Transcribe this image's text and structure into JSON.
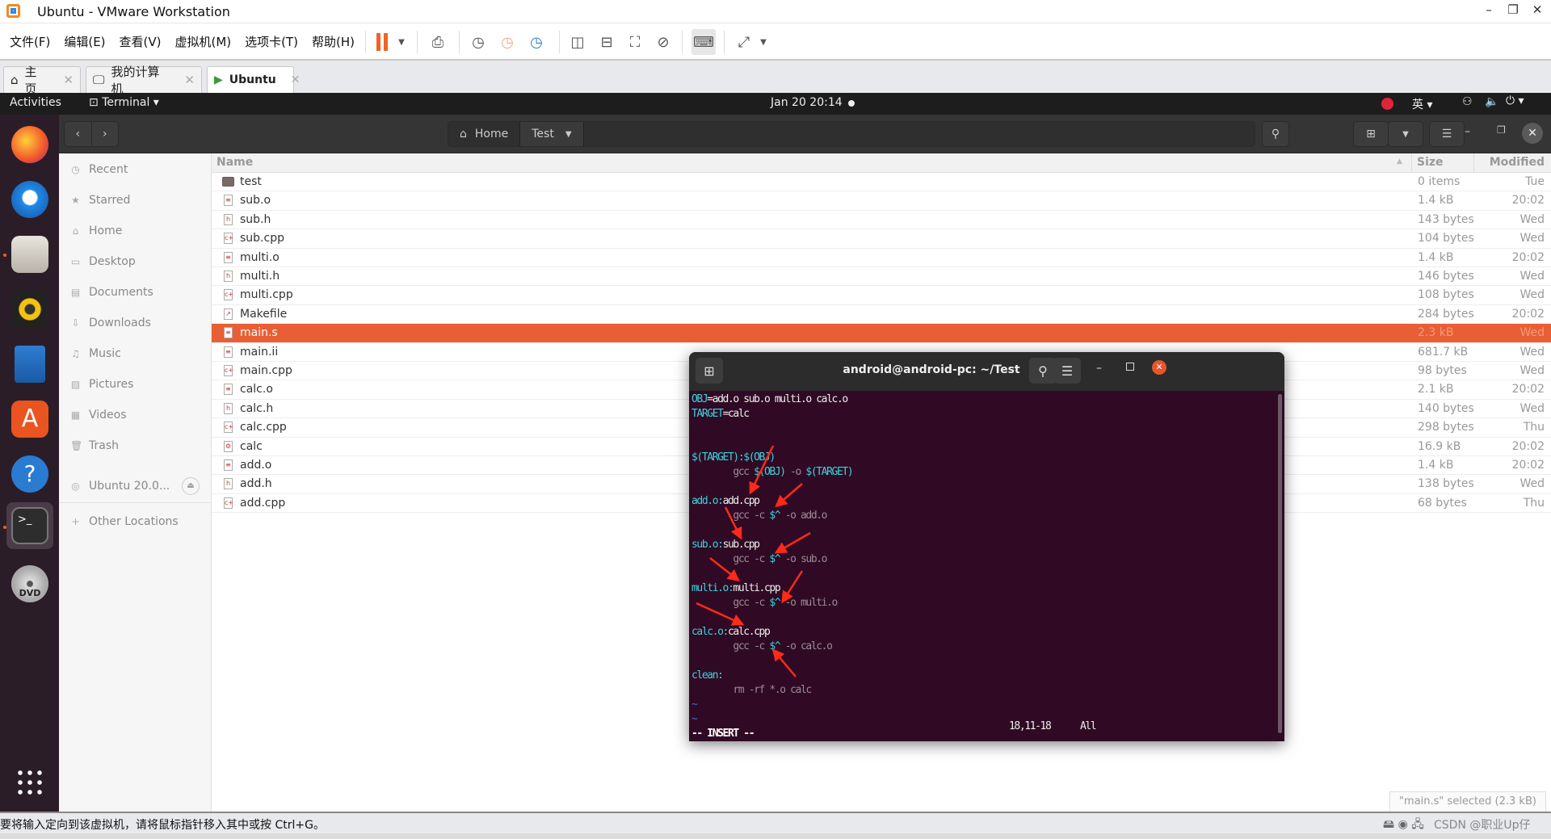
{
  "window": {
    "title": "Ubuntu - VMware Workstation",
    "icon": "vmware-icon"
  },
  "menu": [
    "文件(F)",
    "编辑(E)",
    "查看(V)",
    "虚拟机(M)",
    "选项卡(T)",
    "帮助(H)"
  ],
  "tabs": [
    {
      "label": "主页",
      "icon": "home-icon"
    },
    {
      "label": "我的计算机",
      "icon": "computer-icon"
    },
    {
      "label": "Ubuntu",
      "icon": "vm-running-icon",
      "active": true
    }
  ],
  "topbar": {
    "activities": "Activities",
    "app": "Terminal",
    "clock": "Jan 20  20:14",
    "input_method": "英"
  },
  "files": {
    "path": [
      "Home",
      "Test"
    ],
    "columns": {
      "name": "Name",
      "size": "Size",
      "modified": "Modified"
    },
    "sidebar": [
      {
        "label": "Recent",
        "icon": "clock-icon"
      },
      {
        "label": "Starred",
        "icon": "star-icon"
      },
      {
        "label": "Home",
        "icon": "home-icon"
      },
      {
        "label": "Desktop",
        "icon": "desktop-icon"
      },
      {
        "label": "Documents",
        "icon": "document-icon"
      },
      {
        "label": "Downloads",
        "icon": "download-icon"
      },
      {
        "label": "Music",
        "icon": "music-icon"
      },
      {
        "label": "Pictures",
        "icon": "picture-icon"
      },
      {
        "label": "Videos",
        "icon": "video-icon"
      },
      {
        "label": "Trash",
        "icon": "trash-icon"
      }
    ],
    "device": "Ubuntu 20.0...",
    "other_locations": "Other Locations",
    "rows": [
      {
        "name": "test",
        "size": "0 items",
        "modified": "Tue",
        "type": "folder"
      },
      {
        "name": "sub.o",
        "size": "1.4 kB",
        "modified": "20:02",
        "type": "o"
      },
      {
        "name": "sub.h",
        "size": "143 bytes",
        "modified": "Wed",
        "type": "h"
      },
      {
        "name": "sub.cpp",
        "size": "104 bytes",
        "modified": "Wed",
        "type": "cpp"
      },
      {
        "name": "multi.o",
        "size": "1.4 kB",
        "modified": "20:02",
        "type": "o"
      },
      {
        "name": "multi.h",
        "size": "146 bytes",
        "modified": "Wed",
        "type": "h"
      },
      {
        "name": "multi.cpp",
        "size": "108 bytes",
        "modified": "Wed",
        "type": "cpp"
      },
      {
        "name": "Makefile",
        "size": "284 bytes",
        "modified": "20:02",
        "type": "make"
      },
      {
        "name": "main.s",
        "size": "2.3 kB",
        "modified": "Wed",
        "type": "s",
        "selected": true
      },
      {
        "name": "main.ii",
        "size": "681.7 kB",
        "modified": "Wed",
        "type": "ii"
      },
      {
        "name": "main.cpp",
        "size": "98 bytes",
        "modified": "Wed",
        "type": "cpp"
      },
      {
        "name": "calc.o",
        "size": "2.1 kB",
        "modified": "20:02",
        "type": "o"
      },
      {
        "name": "calc.h",
        "size": "140 bytes",
        "modified": "Wed",
        "type": "h"
      },
      {
        "name": "calc.cpp",
        "size": "298 bytes",
        "modified": "Thu",
        "type": "cpp"
      },
      {
        "name": "calc",
        "size": "16.9 kB",
        "modified": "20:02",
        "type": "exe"
      },
      {
        "name": "add.o",
        "size": "1.4 kB",
        "modified": "20:02",
        "type": "o"
      },
      {
        "name": "add.h",
        "size": "138 bytes",
        "modified": "Wed",
        "type": "h"
      },
      {
        "name": "add.cpp",
        "size": "68 bytes",
        "modified": "Thu",
        "type": "cpp"
      }
    ],
    "selection_status": "\"main.s\" selected (2.3 kB)"
  },
  "terminal": {
    "title": "android@android-pc: ~/Test",
    "lines": [
      [
        [
          "OBJ",
          "cyan"
        ],
        [
          "=add.o sub.o multi.o calc.o",
          "white"
        ]
      ],
      [
        [
          "TARGET",
          "cyan"
        ],
        [
          "=calc",
          "white"
        ]
      ],
      [],
      [],
      [
        [
          "$(TARGET):$(OBJ)",
          "cyan"
        ]
      ],
      [
        [
          "        gcc ",
          "gray"
        ],
        [
          "$(OBJ)",
          "cyan"
        ],
        [
          " -o ",
          "gray"
        ],
        [
          "$(TARGET)",
          "cyan"
        ]
      ],
      [],
      [
        [
          "add.o:",
          "cyan"
        ],
        [
          "add.cpp",
          "white"
        ]
      ],
      [
        [
          "        gcc -c ",
          "gray"
        ],
        [
          "$^",
          "cyan"
        ],
        [
          " -o add.o",
          "gray"
        ]
      ],
      [],
      [
        [
          "sub.o:",
          "cyan"
        ],
        [
          "sub.cpp",
          "white"
        ]
      ],
      [
        [
          "        gcc -c ",
          "gray"
        ],
        [
          "$^",
          "cyan"
        ],
        [
          " -o sub.o",
          "gray"
        ]
      ],
      [],
      [
        [
          "multi.o:",
          "cyan"
        ],
        [
          "multi.cpp",
          "white"
        ]
      ],
      [
        [
          "        gcc -c ",
          "gray"
        ],
        [
          "$^",
          "cyan"
        ],
        [
          " -o multi.o",
          "gray"
        ]
      ],
      [],
      [
        [
          "calc.o:",
          "cyan"
        ],
        [
          "calc.cpp",
          "white"
        ]
      ],
      [
        [
          "        gcc -c ",
          "gray"
        ],
        [
          "$^",
          "cyan"
        ],
        [
          " -o calc.o",
          "gray"
        ]
      ],
      [],
      [
        [
          "clean:",
          "cyan"
        ]
      ],
      [
        [
          "        rm -rf *.o calc",
          "gray"
        ]
      ],
      [
        [
          "~",
          "blue"
        ]
      ],
      [
        [
          "~",
          "blue"
        ]
      ],
      [
        [
          "-- INSERT --",
          "bold"
        ]
      ]
    ],
    "cursor_position": "18,11-18",
    "scroll_position": "All",
    "annotation_color": "#ff2a1a"
  },
  "vmware_status": {
    "message": "要将输入定向到该虚拟机，请将鼠标指针移入其中或按 Ctrl+G。",
    "watermark": "CSDN @职业Up仔"
  },
  "colors": {
    "selection": "#e95e34",
    "terminal_bg": "#300a24",
    "dock_bg": "#2b1d28"
  }
}
